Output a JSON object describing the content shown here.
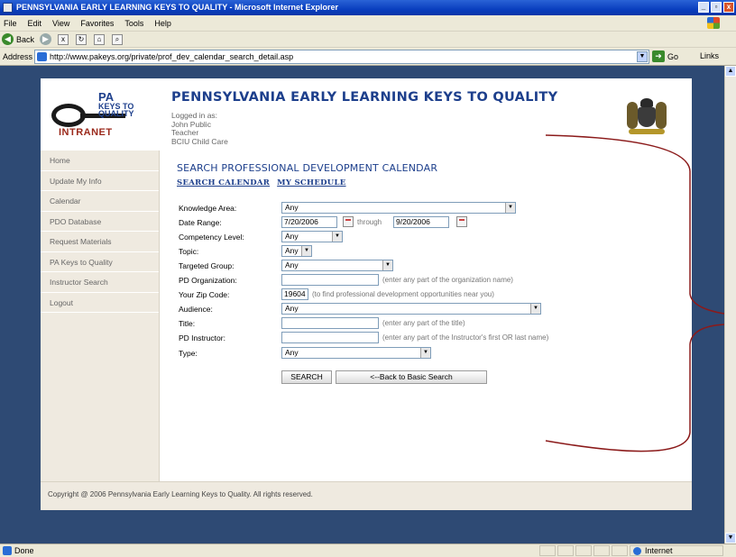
{
  "window": {
    "title": "PENNSYLVANIA EARLY LEARNING KEYS TO QUALITY - Microsoft Internet Explorer",
    "buttons": [
      "_",
      "▫",
      "x"
    ]
  },
  "menu": [
    "File",
    "Edit",
    "View",
    "Favorites",
    "Tools",
    "Help"
  ],
  "toolbar": {
    "back_label": "Back"
  },
  "address": {
    "label": "Address",
    "url": "http://www.pakeys.org/private/prof_dev_calendar_search_detail.asp",
    "go_label": "Go",
    "links_label": "Links"
  },
  "status": {
    "text": "Done",
    "zone": "Internet"
  },
  "site": {
    "logo_top": "PA",
    "logo_mid": "KEYS TO",
    "logo_bot": "QUALITY",
    "logo_word": "INTRANET",
    "title": "PENNSYLVANIA EARLY LEARNING KEYS TO QUALITY",
    "logged_in_label": "Logged in as:",
    "user_name": "John Public",
    "user_role": "Teacher",
    "user_org": "BCIU Child Care"
  },
  "sidebar": {
    "items": [
      {
        "label": "Home"
      },
      {
        "label": "Update My Info"
      },
      {
        "label": "Calendar"
      },
      {
        "label": "PDO Database"
      },
      {
        "label": "Request Materials"
      },
      {
        "label": "PA Keys to Quality"
      },
      {
        "label": "Instructor Search"
      },
      {
        "label": "Logout"
      }
    ]
  },
  "main": {
    "heading": "SEARCH PROFESSIONAL DEVELOPMENT CALENDAR",
    "tab_search": "SEARCH CALENDAR",
    "tab_schedule": "MY SCHEDULE"
  },
  "form": {
    "knowledge_area_label": "Knowledge Area:",
    "knowledge_area_value": "Any",
    "date_range_label": "Date Range:",
    "date_from": "7/20/2006",
    "through_label": "through",
    "date_to": "9/20/2006",
    "competency_label": "Competency Level:",
    "competency_value": "Any",
    "topic_label": "Topic:",
    "topic_value": "Any",
    "targeted_label": "Targeted Group:",
    "targeted_value": "Any",
    "pd_org_label": "PD Organization:",
    "pd_org_value": "",
    "pd_org_hint": "(enter any part of the organization name)",
    "zip_label": "Your Zip Code:",
    "zip_value": "19604",
    "zip_hint": "(to find professional development opportunities near you)",
    "audience_label": "Audience:",
    "audience_value": "Any",
    "title_label": "Title:",
    "title_value": "",
    "title_hint": "(enter any part of the title)",
    "instructor_label": "PD Instructor:",
    "instructor_value": "",
    "instructor_hint": "(enter any part of the Instructor's first OR last name)",
    "type_label": "Type:",
    "type_value": "Any",
    "search_btn": "SEARCH",
    "back_btn": "<--Back to Basic Search"
  },
  "footer": {
    "text": "Copyright @ 2006 Pennsylvania Early Learning Keys to Quality. All rights reserved."
  },
  "colors": {
    "title_blue": "#1d3f8c",
    "page_bg": "#2e4a74",
    "sidebar_bg": "#efeae0",
    "bracket": "#8b1a1a"
  }
}
